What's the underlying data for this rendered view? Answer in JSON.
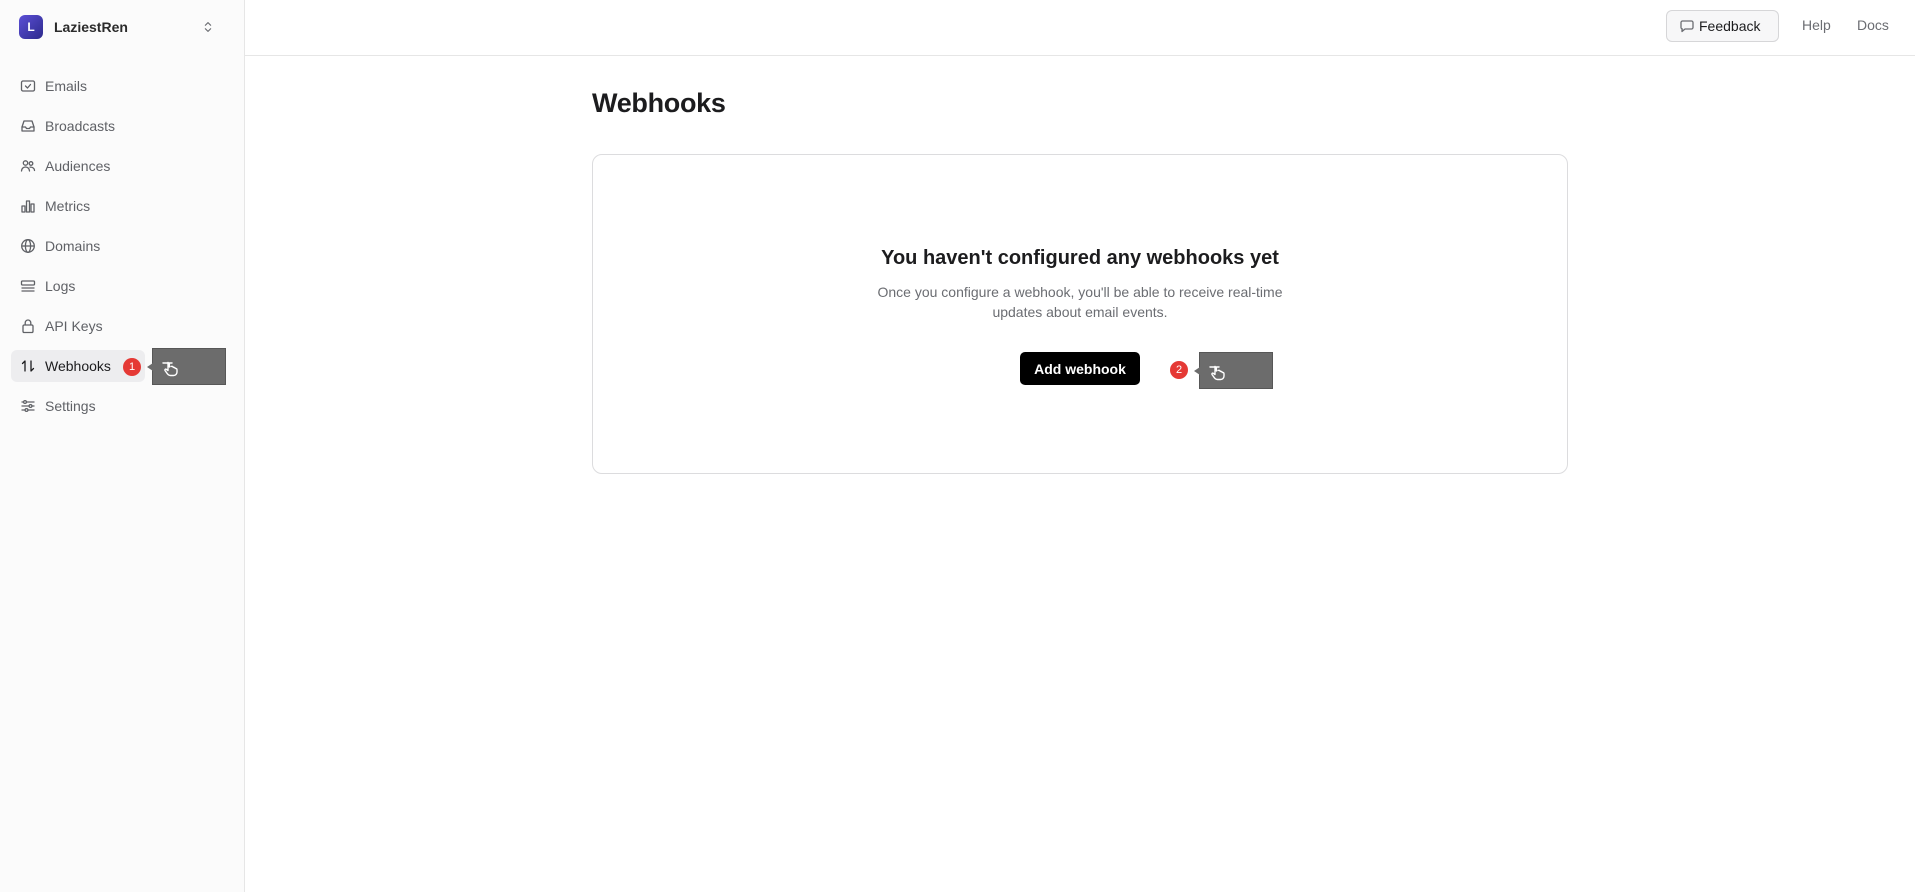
{
  "workspace": {
    "initial": "L",
    "name": "LaziestRen"
  },
  "sidebar": {
    "items": [
      {
        "label": "Emails",
        "icon": "mail-check-icon"
      },
      {
        "label": "Broadcasts",
        "icon": "inbox-icon"
      },
      {
        "label": "Audiences",
        "icon": "users-icon"
      },
      {
        "label": "Metrics",
        "icon": "bar-chart-icon"
      },
      {
        "label": "Domains",
        "icon": "globe-icon"
      },
      {
        "label": "Logs",
        "icon": "logs-icon"
      },
      {
        "label": "API Keys",
        "icon": "lock-icon"
      },
      {
        "label": "Webhooks",
        "icon": "webhook-arrows-icon",
        "active": true
      },
      {
        "label": "Settings",
        "icon": "sliders-icon"
      }
    ]
  },
  "topbar": {
    "feedback_label": "Feedback",
    "help_label": "Help",
    "docs_label": "Docs"
  },
  "main": {
    "title": "Webhooks",
    "empty_title": "You haven't configured any webhooks yet",
    "empty_desc": "Once you configure a webhook, you'll be able to receive real-time updates about email events.",
    "add_button_label": "Add webhook"
  },
  "annotations": [
    {
      "number": "1",
      "icon": "hand-pointer-icon"
    },
    {
      "number": "2",
      "icon": "hand-pointer-icon"
    }
  ]
}
